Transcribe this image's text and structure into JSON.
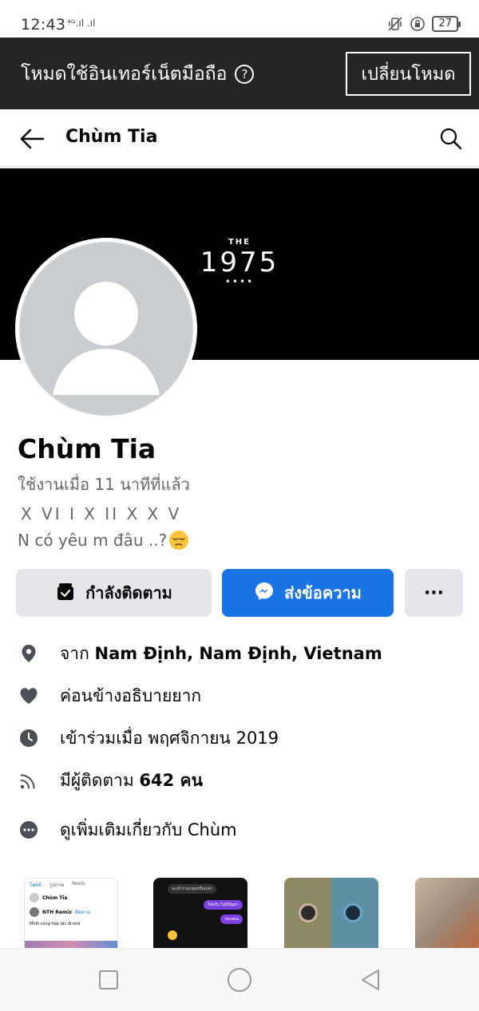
{
  "status_bar": {
    "time": "12:43",
    "signal": "⁴ᴳ.ıl .ıl",
    "battery": "27"
  },
  "mode_banner": {
    "text": "โหมดใช้อินเทอร์เน็ตมือถือ",
    "button_label": "เปลี่ยนโหมด"
  },
  "header": {
    "title": "Chùm Tia"
  },
  "cover": {
    "logo_the": "THE",
    "logo_year": "1975",
    "logo_dots": "••••"
  },
  "profile": {
    "name": "Chùm Tia",
    "last_active": "ใช้งานเมื่อ 11 นาทีที่แล้ว",
    "bio_line1": "X VI  I  X  II X X V",
    "bio_line2": "N có yêu m đâu ..?"
  },
  "actions": {
    "following_label": "กำลังติดตาม",
    "message_label": "ส่งข้อความ",
    "more_label": "···"
  },
  "details": {
    "location_prefix": "จาก ",
    "location": "Nam Định, Nam Định, Vietnam",
    "relationship": "ค่อนข้างอธิบายยาก",
    "joined": "เข้าร่วมเมื่อ พฤศจิกายน  2019",
    "followers_prefix": "มีผู้ติดตาม ",
    "followers": "642 คน",
    "see_more": "ดูเพิ่มเติมเกี่ยวกับ Chùm"
  },
  "thumbnails": {
    "t1_tab1": "โพสต์",
    "t1_tab2": "รูปภาพ",
    "t1_tab3": "Reels",
    "t1_name": "Chùm Tia",
    "t1_sub": "NTH Remix",
    "t1_follow": "ติดตาม",
    "t1_text": "Mình cùng hợp tác đi nhé",
    "t2_header": "จะเข้าร่วมกลุ่มหรือเปล่า",
    "t2_msg1": "ใช่ครับ ไม่มีปัญหา",
    "t2_msg2": "ขอบคุณ"
  },
  "colors": {
    "banner_bg": "#242526",
    "accent_blue": "#1b74e4",
    "button_gray": "#e4e6eb",
    "secondary_text": "#65676b"
  },
  "icons": {
    "back": "back-arrow-icon",
    "search": "search-icon",
    "help": "help-circle-icon",
    "location": "location-pin-icon",
    "heart": "heart-icon",
    "clock": "clock-icon",
    "rss": "rss-icon",
    "more": "more-dots-icon"
  }
}
